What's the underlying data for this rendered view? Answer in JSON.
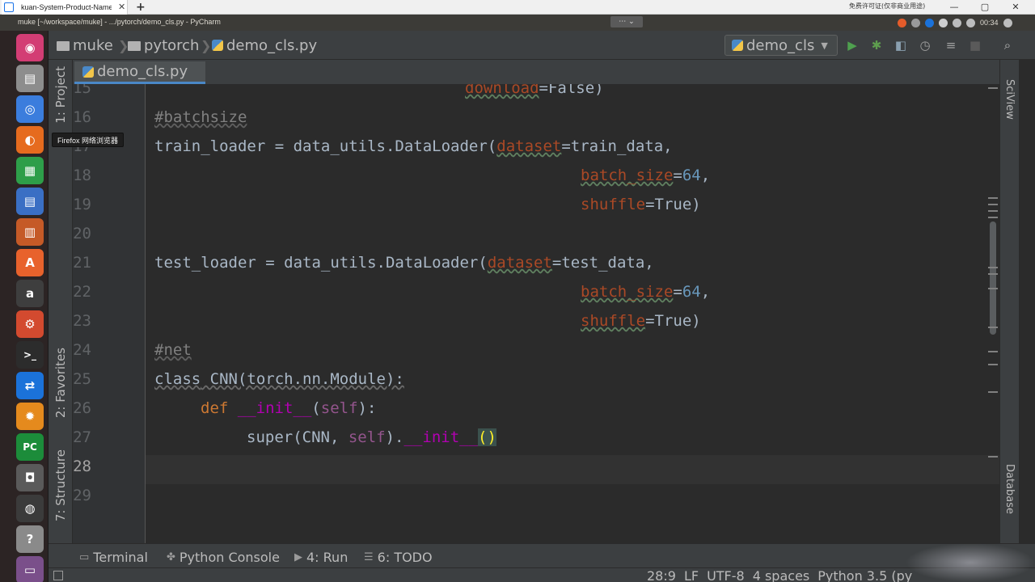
{
  "host": {
    "tab_title": "kuan-System-Product-Name",
    "new_tab": "+",
    "close": "✕",
    "status_text": "免费许可证(仅非商业用途)",
    "min": "—",
    "restore": "▢",
    "close_window": "✕"
  },
  "os_panel": {
    "window_title": "muke [~/workspace/muke] - .../pytorch/demo_cls.py - PyCharm",
    "clock": "00:34"
  },
  "launcher": {
    "items": [
      {
        "name": "ubuntu-dash",
        "glyph": "◉",
        "color": "#d33d74"
      },
      {
        "name": "files",
        "glyph": "▤",
        "color": "#8d8d8d"
      },
      {
        "name": "chrome",
        "glyph": "◎",
        "color": "#3b7ddd"
      },
      {
        "name": "firefox",
        "glyph": "◐",
        "color": "#e66b1e"
      },
      {
        "name": "calc",
        "glyph": "▦",
        "color": "#2e9e49"
      },
      {
        "name": "writer",
        "glyph": "▤",
        "color": "#3a6fc4"
      },
      {
        "name": "impress",
        "glyph": "▥",
        "color": "#c55a27"
      },
      {
        "name": "software-center",
        "glyph": "A",
        "color": "#e8622c"
      },
      {
        "name": "amazon",
        "glyph": "a",
        "color": "#3e3e3e"
      },
      {
        "name": "settings",
        "glyph": "⚙",
        "color": "#d34a2f"
      },
      {
        "name": "terminal",
        "glyph": ">_",
        "color": "#2c2c2c"
      },
      {
        "name": "teamviewer",
        "glyph": "⇄",
        "color": "#1b72d9"
      },
      {
        "name": "settings-2",
        "glyph": "✹",
        "color": "#e58a1d"
      },
      {
        "name": "pycharm",
        "glyph": "PC",
        "color": "#1c8c3a"
      },
      {
        "name": "screenshot",
        "glyph": "◘",
        "color": "#5a5a5a"
      },
      {
        "name": "rhythmbox",
        "glyph": "◍",
        "color": "#3b3b3b"
      },
      {
        "name": "help",
        "glyph": "?",
        "color": "#8a8a8a"
      },
      {
        "name": "trash",
        "glyph": "▭",
        "color": "#7a4f8a"
      }
    ],
    "tooltip": "Firefox 网络浏览器"
  },
  "navbar": {
    "crumbs": [
      "muke",
      "pytorch",
      "demo_cls.py"
    ],
    "run_config": "demo_cls"
  },
  "tool_windows": {
    "project": "1: Project",
    "favorites": "2: Favorites",
    "structure": "7: Structure",
    "sciview": "SciView",
    "database": "Database"
  },
  "editor_tab": {
    "label": "demo_cls.py"
  },
  "editor": {
    "line_numbers": [
      "15",
      "16",
      "17",
      "18",
      "19",
      "20",
      "21",
      "22",
      "23",
      "24",
      "25",
      "26",
      "27",
      "28",
      "29"
    ],
    "current_line": "28",
    "code": {
      "l15_param": "download",
      "l15_rest": "=False)",
      "l16_comment": "#batchsize",
      "l17_a": "train_loader = data_utils.DataLoader(",
      "l17_param": "dataset",
      "l17_b": "=train_data,",
      "l18_param": "batch_size",
      "l18_eq": "=",
      "l18_num": "64",
      "l18_end": ",",
      "l19_param": "shuffle",
      "l19_b": "=True)",
      "l21_a": "test_loader = data_utils.DataLoader(",
      "l21_param": "dataset",
      "l21_b": "=test_data,",
      "l22_param": "batch_size",
      "l22_eq": "=",
      "l22_num": "64",
      "l22_end": ",",
      "l23_param": "shuffle",
      "l23_b": "=True)",
      "l24_comment": "#net",
      "l25_kw": "class",
      "l25_rest": " CNN(torch.nn.Module):",
      "l26_kw": "def",
      "l26_sp": " ",
      "l26_name": "__init__",
      "l26_open": "(",
      "l26_self": "self",
      "l26_close": "):",
      "l27_a": "super(CNN, ",
      "l27_self": "self",
      "l27_dot": ").",
      "l27_name": "__init__",
      "l27_paren": "()"
    }
  },
  "bottom_tools": {
    "terminal": "Terminal",
    "python_console": "Python Console",
    "run": "4: Run",
    "todo": "6: TODO"
  },
  "status": {
    "position": "28:9",
    "line_sep": "LF",
    "encoding": "UTF-8",
    "indent": "4 spaces",
    "interpreter": "Python 3.5 (py"
  },
  "colors": {
    "editor_bg": "#2b2b2b",
    "keyword": "#cc7832",
    "comment": "#808080",
    "param": "#aa4926",
    "number": "#6897bb",
    "self": "#94558d",
    "dunder": "#b200b2",
    "accent": "#4a88c7"
  }
}
